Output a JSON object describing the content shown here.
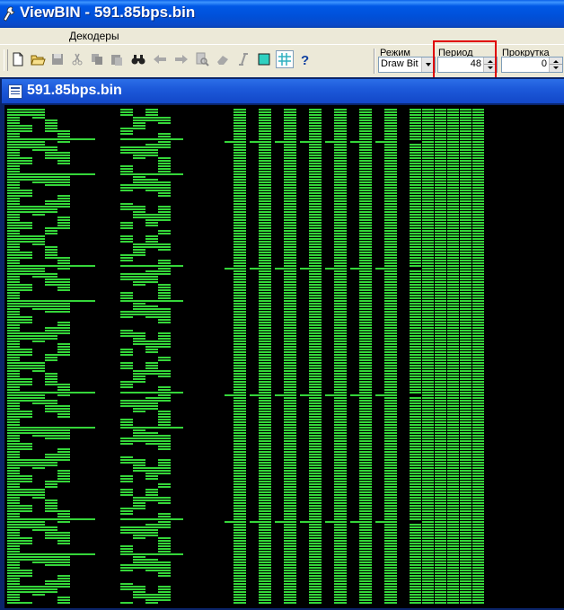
{
  "window": {
    "title": "ViewBIN - 591.85bps.bin",
    "icon": "wrench-icon"
  },
  "menu": {
    "items": [
      "Декодеры"
    ]
  },
  "toolbar": {
    "buttons": [
      "new-file-icon",
      "open-folder-icon",
      "save-icon",
      "cut-icon",
      "copy-icon",
      "paste-icon",
      "binoculars-icon",
      "arrow-left-icon",
      "arrow-right-icon",
      "zoom-icon",
      "eraser-icon",
      "italic-icon",
      "square-icon",
      "grid-icon",
      "help-icon"
    ],
    "mode_label": "Режим",
    "mode_value": "Draw Bit",
    "period_label": "Период",
    "period_value": "48",
    "scroll_label": "Прокрутка",
    "scroll_value": "0"
  },
  "child_window": {
    "title": "591.85bps.bin",
    "icon": "document-icon"
  },
  "colors": {
    "bit_on": "#35D63A",
    "background": "#000000",
    "highlight": "#E00000"
  }
}
